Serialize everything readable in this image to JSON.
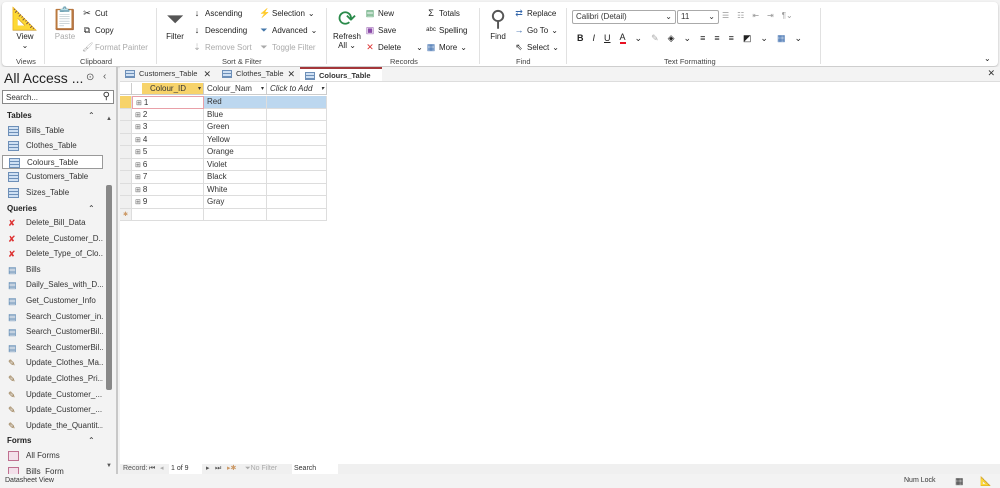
{
  "ribbon": {
    "views": {
      "view": "View",
      "group": "Views"
    },
    "clipboard": {
      "paste": "Paste",
      "cut": "Cut",
      "copy": "Copy",
      "format_painter": "Format Painter",
      "group": "Clipboard"
    },
    "sort_filter": {
      "filter": "Filter",
      "ascending": "Ascending",
      "descending": "Descending",
      "remove_sort": "Remove Sort",
      "selection": "Selection",
      "advanced": "Advanced",
      "toggle_filter": "Toggle Filter",
      "group": "Sort & Filter"
    },
    "records": {
      "refresh": "Refresh",
      "refresh2": "All",
      "new": "New",
      "save": "Save",
      "delete": "Delete",
      "totals": "Totals",
      "spelling": "Spelling",
      "more": "More",
      "group": "Records"
    },
    "find": {
      "find": "Find",
      "replace": "Replace",
      "goto": "Go To",
      "select": "Select",
      "group": "Find"
    },
    "text_formatting": {
      "font": "Calibri (Detail)",
      "size": "11",
      "group": "Text Formatting",
      "bold": "B",
      "italic": "I",
      "underline": "U",
      "font_color": "#e81123"
    }
  },
  "nav": {
    "title": "All Access ...",
    "search_placeholder": "Search...",
    "sections": [
      {
        "label": "Tables",
        "items": [
          "Bills_Table",
          "Clothes_Table",
          "Colours_Table",
          "Customers_Table",
          "Sizes_Table"
        ]
      },
      {
        "label": "Queries",
        "items": [
          "Delete_Bill_Data",
          "Delete_Customer_D...",
          "Delete_Type_of_Clo...",
          "Bills",
          "Daily_Sales_with_D...",
          "Get_Customer_Info",
          "Search_Customer_in...",
          "Search_CustomerBil...",
          "Search_CustomerBil...",
          "Update_Clothes_Ma...",
          "Update_Clothes_Pri...",
          "Update_Customer_...",
          "Update_Customer_...",
          "Update_the_Quantit..."
        ]
      },
      {
        "label": "Forms",
        "items": [
          "All Forms",
          "Bills_Form"
        ]
      }
    ]
  },
  "tabs": [
    {
      "label": "Customers_Table"
    },
    {
      "label": "Clothes_Table"
    },
    {
      "label": "Colours_Table"
    }
  ],
  "sheet": {
    "columns": [
      "Colour_ID",
      "Colour_Nam",
      "Click to Add"
    ],
    "rows": [
      [
        "1",
        "Red"
      ],
      [
        "2",
        "Blue"
      ],
      [
        "3",
        "Green"
      ],
      [
        "4",
        "Yellow"
      ],
      [
        "5",
        "Orange"
      ],
      [
        "6",
        "Violet"
      ],
      [
        "7",
        "Black"
      ],
      [
        "8",
        "White"
      ],
      [
        "9",
        "Gray"
      ]
    ]
  },
  "recnav": {
    "label": "Record:",
    "position": "1 of 9",
    "filter": "No Filter",
    "search": "Search"
  },
  "status": {
    "left": "Datasheet View",
    "numlock": "Num Lock"
  }
}
